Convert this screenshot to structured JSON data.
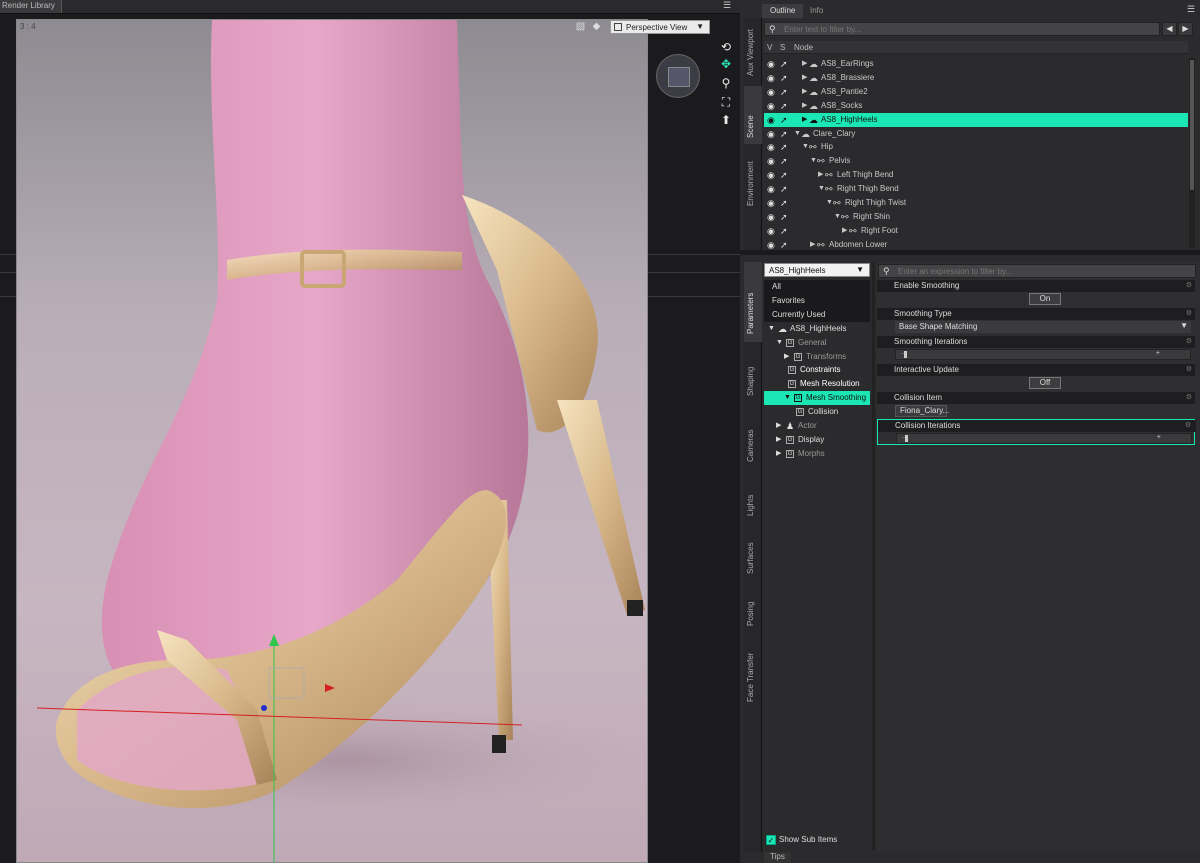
{
  "window": {
    "render_tab": "Render Library"
  },
  "viewport": {
    "ratio_label": "3 : 4",
    "view_menu": "Perspective View",
    "tools": [
      "render-preview-icon",
      "lighting-icon",
      "orbit-icon",
      "pan-move-icon",
      "zoom-icon",
      "frame-icon",
      "reset-view-icon"
    ]
  },
  "side_tabs_top": [
    "Aux Viewport",
    "Scene",
    "Environment"
  ],
  "side_tabs_bottom": [
    "Parameters",
    "Shaping",
    "Cameras",
    "Lights",
    "Surfaces",
    "Posing",
    "Face Transfer"
  ],
  "scene": {
    "tabs": [
      "Outline",
      "Info"
    ],
    "filter_placeholder": "Enter text to filter by...",
    "columns": {
      "v": "V",
      "s": "S",
      "node": "Node"
    },
    "rows": [
      {
        "label": "AS8_EarRings",
        "selected": false
      },
      {
        "label": "AS8_Brassiere",
        "selected": false
      },
      {
        "label": "AS8_Pantie2",
        "selected": false
      },
      {
        "label": "AS8_Socks",
        "selected": false
      },
      {
        "label": "AS8_HighHeels",
        "selected": true
      },
      {
        "label": "Clare_Clary",
        "selected": false
      },
      {
        "label": "Hip",
        "selected": false
      },
      {
        "label": "Pelvis",
        "selected": false
      },
      {
        "label": "Left Thigh Bend",
        "selected": false
      },
      {
        "label": "Right Thigh Bend",
        "selected": false
      },
      {
        "label": "Right Thigh Twist",
        "selected": false
      },
      {
        "label": "Right Shin",
        "selected": false
      },
      {
        "label": "Right Foot",
        "selected": false
      },
      {
        "label": "Abdomen Lower",
        "selected": false
      }
    ]
  },
  "parameters": {
    "node_select": "AS8_HighHeels",
    "filter_placeholder": "Enter an expression to filter by...",
    "tree": [
      {
        "label": "All"
      },
      {
        "label": "Favorites"
      },
      {
        "label": "Currently Used"
      },
      {
        "label": "AS8_HighHeels"
      },
      {
        "label": "General"
      },
      {
        "label": "Transforms"
      },
      {
        "label": "Constraints"
      },
      {
        "label": "Mesh Resolution"
      },
      {
        "label": "Mesh Smoothing"
      },
      {
        "label": "Collision"
      },
      {
        "label": "Actor"
      },
      {
        "label": "Display"
      },
      {
        "label": "Morphs"
      }
    ],
    "show_sub_items": "Show Sub Items",
    "props": {
      "enable_smoothing": {
        "title": "Enable Smoothing",
        "value": "On"
      },
      "smoothing_type": {
        "title": "Smoothing Type",
        "value": "Base Shape Matching"
      },
      "smoothing_iterations": {
        "title": "Smoothing Iterations",
        "value": 0
      },
      "interactive_update": {
        "title": "Interactive Update",
        "value": "Off"
      },
      "collision_item": {
        "title": "Collision Item",
        "value": "Fiona_Clary..."
      },
      "collision_iterations": {
        "title": "Collision Iterations",
        "value": 0
      }
    },
    "tips_tab": "Tips"
  },
  "colors": {
    "accent": "#1be7b5",
    "panel_bg": "#2b2b2d",
    "viewport_bg": "#1b1b1d"
  }
}
